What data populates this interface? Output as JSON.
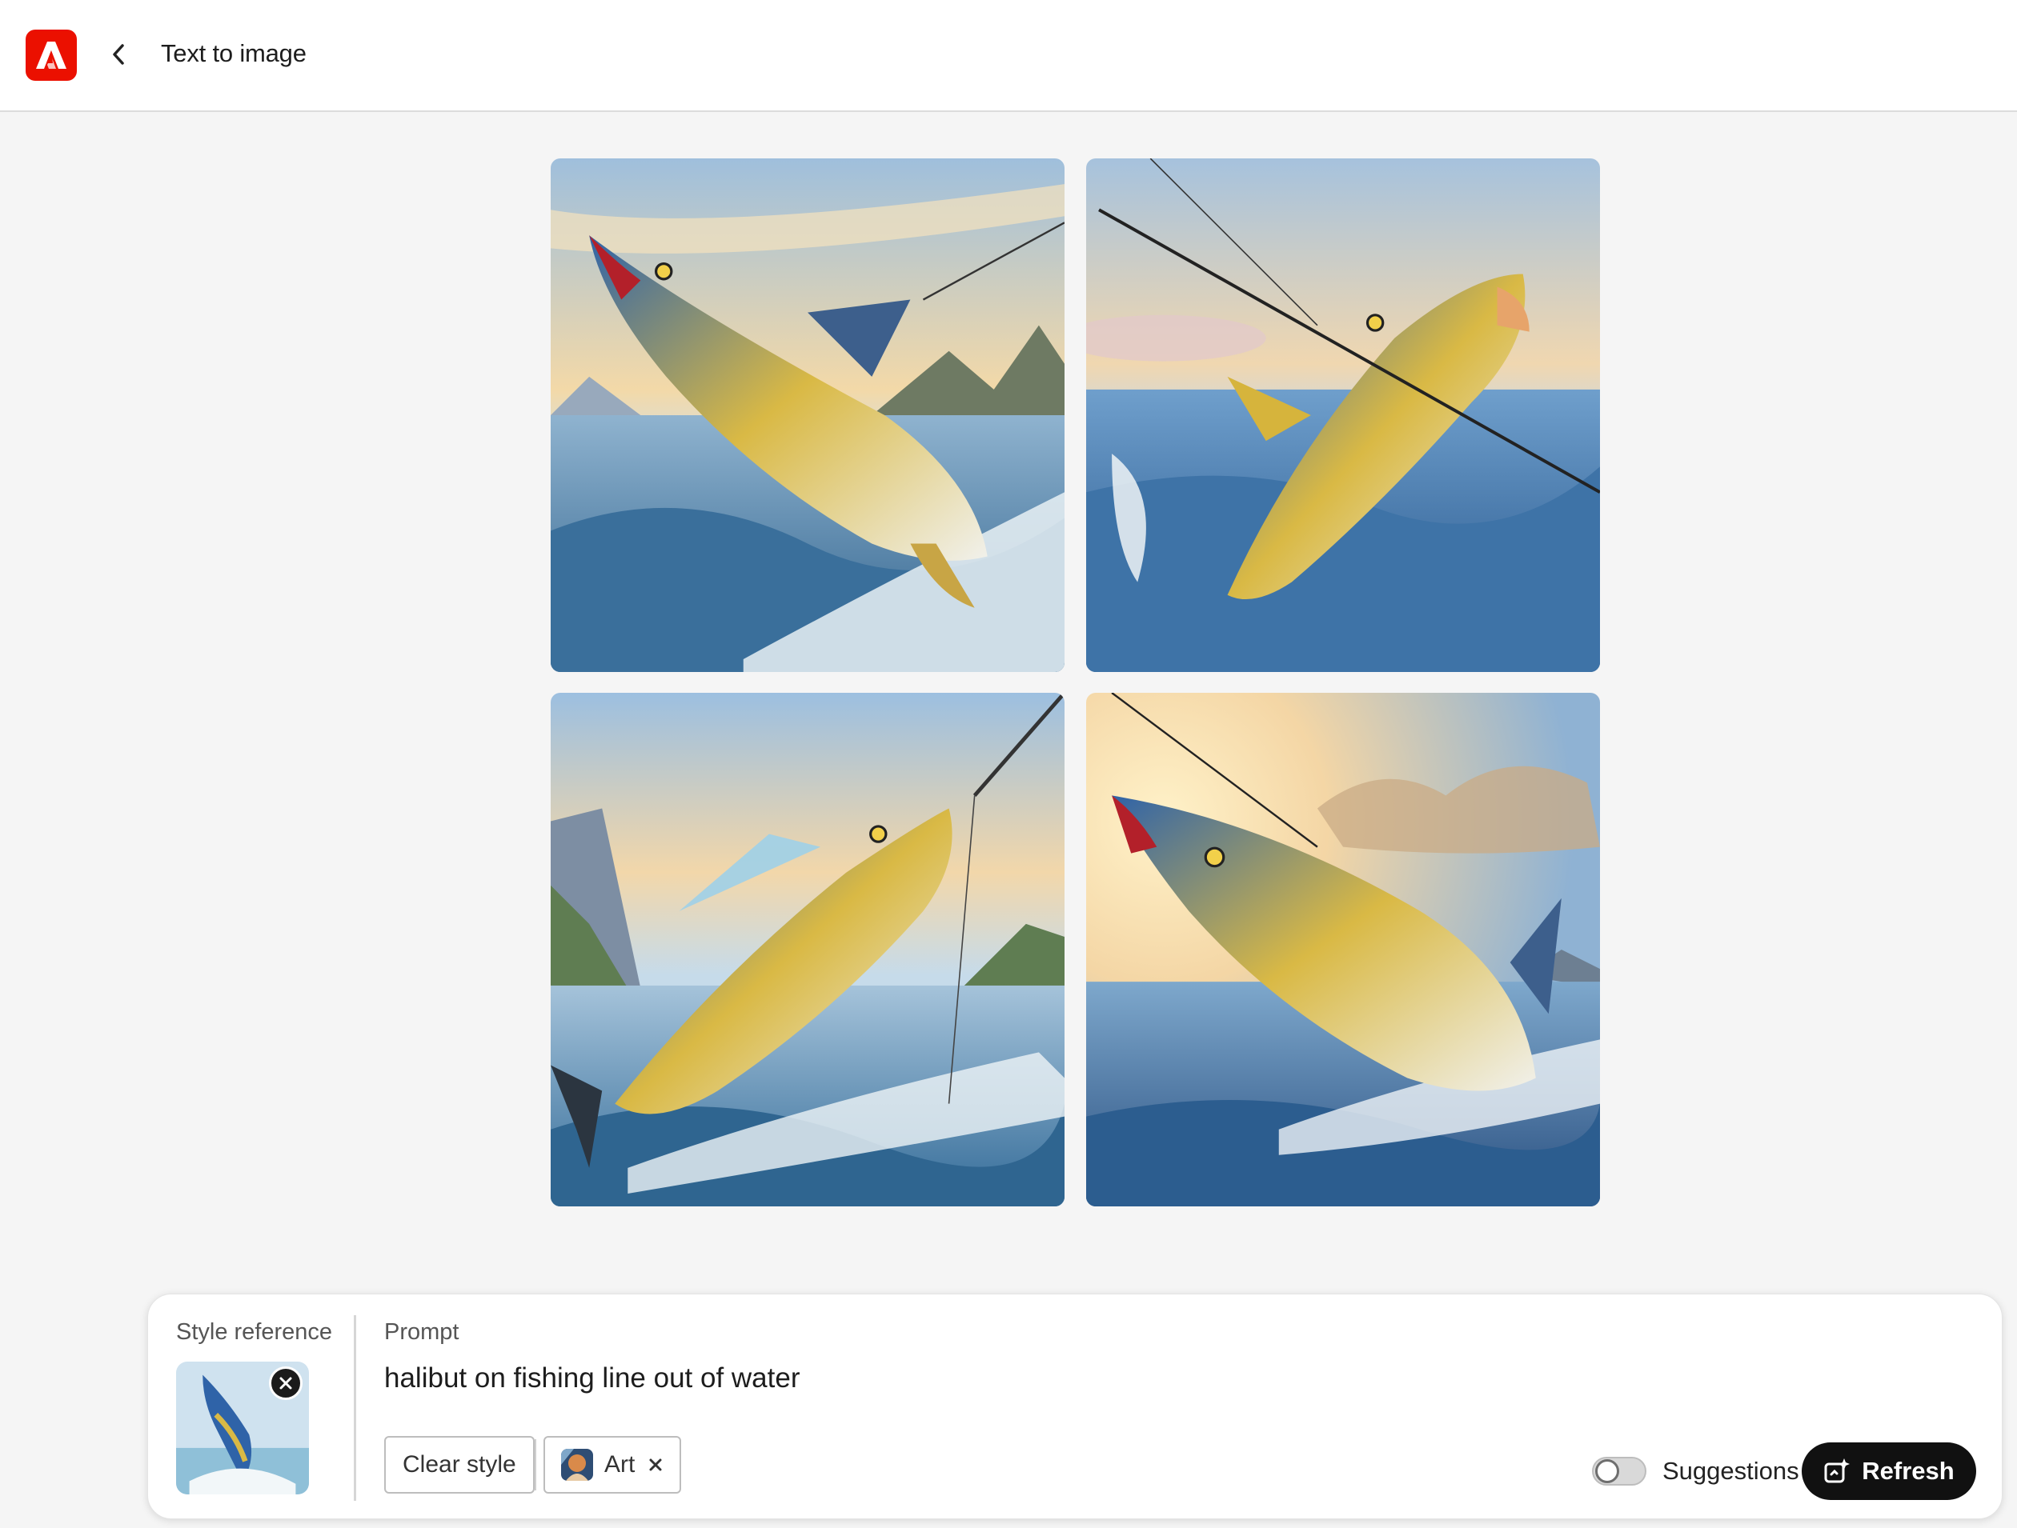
{
  "header": {
    "title": "Text to image",
    "logo_icon": "adobe-logo-icon",
    "back_icon": "chevron-left-icon"
  },
  "results": {
    "images": [
      {
        "alt": "Fish leaping from waves on fishing line, variation 1"
      },
      {
        "alt": "Fish leaping from waves on fishing line, variation 2"
      },
      {
        "alt": "Fish leaping from waves on fishing line, variation 3"
      },
      {
        "alt": "Fish leaping from waves on fishing line, variation 4"
      }
    ]
  },
  "prompt_panel": {
    "style_reference_label": "Style reference",
    "prompt_label": "Prompt",
    "prompt_text": "halibut on fishing line out of water",
    "clear_style_label": "Clear style",
    "style_tag_label": "Art",
    "suggestions_label": "Suggestions",
    "suggestions_enabled": false,
    "refresh_label": "Refresh"
  },
  "colors": {
    "brand": "#eb1000",
    "primary_button": "#111111",
    "background": "#f5f5f5"
  }
}
